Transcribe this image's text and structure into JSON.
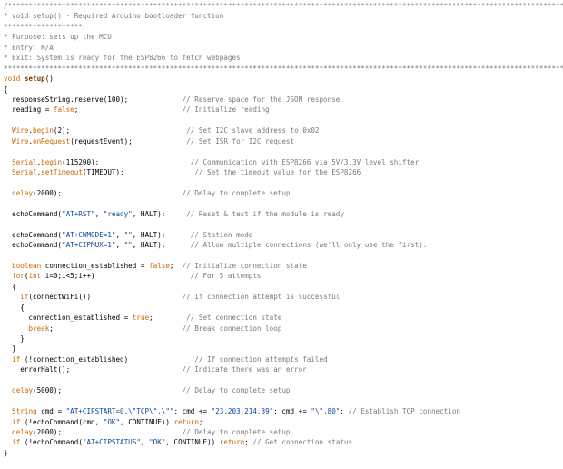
{
  "editor": {
    "colors": {
      "background": "#ffffff",
      "text": "#000000",
      "comment": "#7a7a7a",
      "string": "#0a4a9a",
      "keyword": "#cc6600",
      "function_name": "#7a3d00",
      "library": "#cc6600"
    },
    "lines": [
      [
        [
          "c",
          "/**********************************************************************************************************************************************************"
        ]
      ],
      [
        [
          "c",
          "* void setup() - Required Arduino bootloader function"
        ]
      ],
      [
        [
          "c",
          "*******************"
        ]
      ],
      [
        [
          "c",
          "* Purpose: sets up the MCU"
        ]
      ],
      [
        [
          "c",
          "* Entry: N/A"
        ]
      ],
      [
        [
          "c",
          "* Exit: System is ready for the ESP8266 to fetch webpages"
        ]
      ],
      [
        [
          "c",
          "*********************************************************************************************************************************************************/"
        ]
      ],
      [
        [
          "k",
          "void "
        ],
        [
          "kb",
          "setup"
        ],
        [
          "t",
          "()"
        ]
      ],
      [
        [
          "t",
          "{"
        ]
      ],
      [
        [
          "t",
          "  responseString.reserve(100);             "
        ],
        [
          "c",
          "// Reserve space for the JSON response"
        ]
      ],
      [
        [
          "t",
          "  reading = "
        ],
        [
          "k",
          "false"
        ],
        [
          "t",
          ";                         "
        ],
        [
          "c",
          "// Initialize reading"
        ]
      ],
      [
        [
          "t",
          ""
        ]
      ],
      [
        [
          "t",
          "  "
        ],
        [
          "l",
          "Wire"
        ],
        [
          "t",
          "."
        ],
        [
          "f",
          "begin"
        ],
        [
          "t",
          "(2);                            "
        ],
        [
          "c",
          "// Set I2C slave address to 0x02"
        ]
      ],
      [
        [
          "t",
          "  "
        ],
        [
          "l",
          "Wire"
        ],
        [
          "t",
          "."
        ],
        [
          "f",
          "onRequest"
        ],
        [
          "t",
          "(requestEvent);             "
        ],
        [
          "c",
          "// Set ISR for I2C request"
        ]
      ],
      [
        [
          "t",
          ""
        ]
      ],
      [
        [
          "t",
          "  "
        ],
        [
          "l",
          "Serial"
        ],
        [
          "t",
          "."
        ],
        [
          "f",
          "begin"
        ],
        [
          "t",
          "(115200);                      "
        ],
        [
          "c",
          "// Communication with ESP8266 via 5V/3.3V level shifter"
        ]
      ],
      [
        [
          "t",
          "  "
        ],
        [
          "l",
          "Serial"
        ],
        [
          "t",
          "."
        ],
        [
          "f",
          "setTimeout"
        ],
        [
          "t",
          "(TIMEOUT);                 "
        ],
        [
          "c",
          "// Set the timeout value for the ESP8266"
        ]
      ],
      [
        [
          "t",
          ""
        ]
      ],
      [
        [
          "t",
          "  "
        ],
        [
          "f",
          "delay"
        ],
        [
          "t",
          "(2000);                             "
        ],
        [
          "c",
          "// Delay to complete setup"
        ]
      ],
      [
        [
          "t",
          ""
        ]
      ],
      [
        [
          "t",
          "  echoCommand("
        ],
        [
          "s",
          "\"AT+RST\""
        ],
        [
          "t",
          ", "
        ],
        [
          "s",
          "\"ready\""
        ],
        [
          "t",
          ", HALT);     "
        ],
        [
          "c",
          "// Reset & test if the module is ready"
        ]
      ],
      [
        [
          "t",
          ""
        ]
      ],
      [
        [
          "t",
          "  echoCommand("
        ],
        [
          "s",
          "\"AT+CWMODE=1\""
        ],
        [
          "t",
          ", "
        ],
        [
          "s",
          "\"\""
        ],
        [
          "t",
          ", HALT);      "
        ],
        [
          "c",
          "// Station mode"
        ]
      ],
      [
        [
          "t",
          "  echoCommand("
        ],
        [
          "s",
          "\"AT+CIPMUX=1\""
        ],
        [
          "t",
          ", "
        ],
        [
          "s",
          "\"\""
        ],
        [
          "t",
          ", HALT);      "
        ],
        [
          "c",
          "// Allow multiple connections (we'll only use the first)."
        ]
      ],
      [
        [
          "t",
          ""
        ]
      ],
      [
        [
          "t",
          "  "
        ],
        [
          "k",
          "boolean"
        ],
        [
          "t",
          " connection_established = "
        ],
        [
          "k",
          "false"
        ],
        [
          "t",
          ";  "
        ],
        [
          "c",
          "// Initialize connection state"
        ]
      ],
      [
        [
          "t",
          "  "
        ],
        [
          "k",
          "for"
        ],
        [
          "t",
          "("
        ],
        [
          "k",
          "int"
        ],
        [
          "t",
          " i=0;i<5;i++)                       "
        ],
        [
          "c",
          "// For 5 attempts"
        ]
      ],
      [
        [
          "t",
          "  {"
        ]
      ],
      [
        [
          "t",
          "    "
        ],
        [
          "k",
          "if"
        ],
        [
          "t",
          "(connectWiFi())                      "
        ],
        [
          "c",
          "// If connection attempt is successful"
        ]
      ],
      [
        [
          "t",
          "    {"
        ]
      ],
      [
        [
          "t",
          "      connection_established = "
        ],
        [
          "k",
          "true"
        ],
        [
          "t",
          ";        "
        ],
        [
          "c",
          "// Set connection state"
        ]
      ],
      [
        [
          "t",
          "      "
        ],
        [
          "k",
          "break"
        ],
        [
          "t",
          ";                               "
        ],
        [
          "c",
          "// Break connection loop"
        ]
      ],
      [
        [
          "t",
          "    }"
        ]
      ],
      [
        [
          "t",
          "  }"
        ]
      ],
      [
        [
          "t",
          "  "
        ],
        [
          "k",
          "if"
        ],
        [
          "t",
          " (!connection_established)                "
        ],
        [
          "c",
          "// If connection attempts failed"
        ]
      ],
      [
        [
          "t",
          "    errorHalt();                           "
        ],
        [
          "c",
          "// Indicate there was an error"
        ]
      ],
      [
        [
          "t",
          ""
        ]
      ],
      [
        [
          "t",
          "  "
        ],
        [
          "f",
          "delay"
        ],
        [
          "t",
          "(5000);                             "
        ],
        [
          "c",
          "// Delay to complete setup"
        ]
      ],
      [
        [
          "t",
          ""
        ]
      ],
      [
        [
          "t",
          "  "
        ],
        [
          "l",
          "String"
        ],
        [
          "t",
          " cmd = "
        ],
        [
          "s",
          "\"AT+CIPSTART=0,\\\"TCP\\\",\\\"\""
        ],
        [
          "t",
          "; cmd += "
        ],
        [
          "s",
          "\"23.203.214.89\""
        ],
        [
          "t",
          "; cmd += "
        ],
        [
          "s",
          "\"\\\",80\""
        ],
        [
          "t",
          "; "
        ],
        [
          "c",
          "// Establish TCP connection"
        ]
      ],
      [
        [
          "t",
          "  "
        ],
        [
          "k",
          "if"
        ],
        [
          "t",
          " (!echoCommand(cmd, "
        ],
        [
          "s",
          "\"OK\""
        ],
        [
          "t",
          ", CONTINUE)) "
        ],
        [
          "k",
          "return"
        ],
        [
          "t",
          ";"
        ]
      ],
      [
        [
          "t",
          "  "
        ],
        [
          "f",
          "delay"
        ],
        [
          "t",
          "(2000);                             "
        ],
        [
          "c",
          "// Delay to complete setup"
        ]
      ],
      [
        [
          "t",
          "  "
        ],
        [
          "k",
          "if"
        ],
        [
          "t",
          " (!echoCommand("
        ],
        [
          "s",
          "\"AT+CIPSTATUS\""
        ],
        [
          "t",
          ", "
        ],
        [
          "s",
          "\"OK\""
        ],
        [
          "t",
          ", CONTINUE)) "
        ],
        [
          "k",
          "return"
        ],
        [
          "t",
          "; "
        ],
        [
          "c",
          "// Get connection status"
        ]
      ],
      [
        [
          "t",
          "}"
        ]
      ]
    ]
  }
}
